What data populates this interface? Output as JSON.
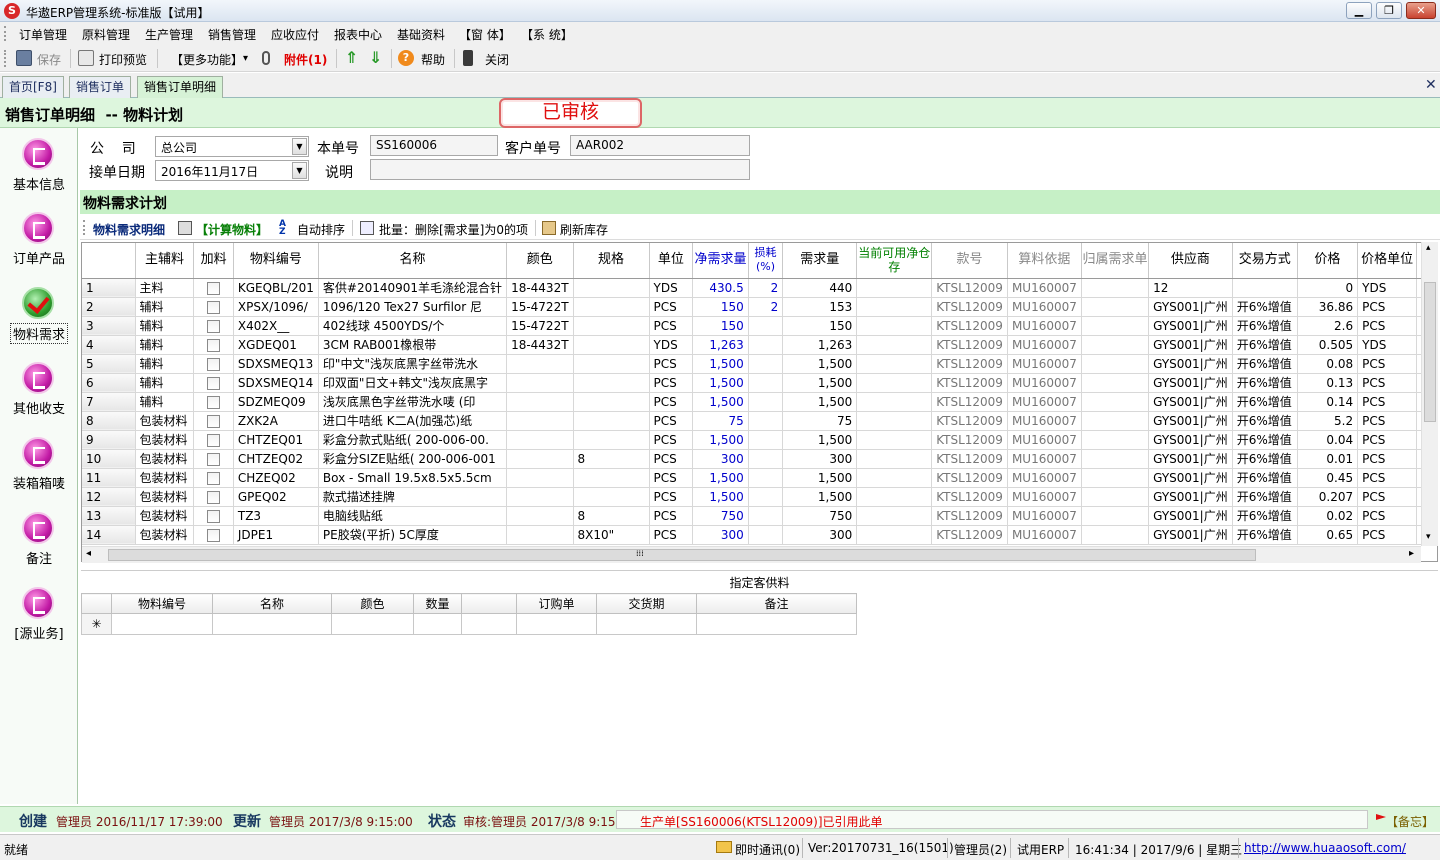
{
  "window": {
    "app_logo": "S",
    "title": "华遨ERP管理系统-标准版【试用】",
    "btn_min": "▁",
    "btn_max": "❐",
    "btn_close": "✕"
  },
  "menu": [
    "订单管理",
    "原料管理",
    "生产管理",
    "销售管理",
    "应收应付",
    "报表中心",
    "基础资料",
    "【窗 体】",
    "【系 统】"
  ],
  "toolbar": {
    "save": "保存",
    "print_preview": "打印预览",
    "more": "【更多功能】",
    "more_arrow": "▾",
    "attach": "附件(1)",
    "help": "帮助",
    "close": "关闭",
    "up_arrow": "⇑",
    "down_arrow": "⇓",
    "help_glyph": "?"
  },
  "tabs": [
    "首页[F8]",
    "销售订单",
    "销售订单明细"
  ],
  "tab_close": "✕",
  "header": {
    "title": "销售订单明细  -- 物料计划",
    "status_stamp": "已审核"
  },
  "sidebar": [
    "基本信息",
    "订单产品",
    "物料需求",
    "其他收支",
    "装箱箱唛",
    "备注",
    "[源业务]"
  ],
  "form": {
    "company_label": "公    司",
    "company_value": "总公司",
    "order_no_label": "本单号",
    "order_no_value": "SS160006",
    "customer_no_label": "客户单号",
    "customer_no_value": "AAR002",
    "date_label": "接单日期",
    "date_value": "2016年11月17日",
    "note_label": "说明",
    "note_value": "",
    "dropdown_glyph": "▼"
  },
  "section_title": "物料需求计划",
  "subbar": {
    "detail": "物料需求明细",
    "calc": "【计算物料】",
    "sort": "自动排序",
    "batch": "批量：删除[需求量]为0的项",
    "refresh": "刷新库存"
  },
  "grid": {
    "headers": [
      "",
      "主辅料",
      "加料",
      "物料编号",
      "名称",
      "颜色",
      "规格",
      "单位",
      "净需求量",
      "损耗(%)",
      "需求量",
      "当前可用净仓存",
      "款号",
      "算料依据",
      "归属需求单",
      "供应商",
      "交易方式",
      "价格",
      "价格单位",
      ""
    ],
    "rows": [
      {
        "no": "1",
        "type": "主料",
        "code": "KGEQBL/201",
        "name": "客供#20140901羊毛涤纶混合针",
        "color": "18-4432T",
        "spec": "",
        "unit": "YDS",
        "net": "430.5",
        "loss": "2",
        "qty": "440",
        "stock": "",
        "style": "KTSL12009",
        "basis": "MU160007",
        "belong": "",
        "supplier": "12",
        "trade": "",
        "price": "0",
        "punit": "YDS"
      },
      {
        "no": "2",
        "type": "辅料",
        "code": "XPSX/1096/",
        "name": "1096/120  Tex27 Surfilor 尼",
        "color": "15-4722T",
        "spec": "",
        "unit": "PCS",
        "net": "150",
        "loss": "2",
        "qty": "153",
        "stock": "",
        "style": "KTSL12009",
        "basis": "MU160007",
        "belong": "",
        "supplier": "GYS001|广州",
        "trade": "开6%增值",
        "price": "36.86",
        "punit": "PCS"
      },
      {
        "no": "3",
        "type": "辅料",
        "code": "X402X__",
        "name": "402线球 4500YDS/个",
        "color": "15-4722T",
        "spec": "",
        "unit": "PCS",
        "net": "150",
        "loss": "",
        "qty": "150",
        "stock": "",
        "style": "KTSL12009",
        "basis": "MU160007",
        "belong": "",
        "supplier": "GYS001|广州",
        "trade": "开6%增值",
        "price": "2.6",
        "punit": "PCS"
      },
      {
        "no": "4",
        "type": "辅料",
        "code": "XGDEQ01",
        "name": "3CM RAB001橡根带",
        "color": "18-4432T",
        "spec": "",
        "unit": "YDS",
        "net": "1,263",
        "loss": "",
        "qty": "1,263",
        "stock": "",
        "style": "KTSL12009",
        "basis": "MU160007",
        "belong": "",
        "supplier": "GYS001|广州",
        "trade": "开6%增值",
        "price": "0.505",
        "punit": "YDS"
      },
      {
        "no": "5",
        "type": "辅料",
        "code": "SDXSMEQ13",
        "name": "印\"中文\"浅灰底黑字丝带洗水",
        "color": "",
        "spec": "",
        "unit": "PCS",
        "net": "1,500",
        "loss": "",
        "qty": "1,500",
        "stock": "",
        "style": "KTSL12009",
        "basis": "MU160007",
        "belong": "",
        "supplier": "GYS001|广州",
        "trade": "开6%增值",
        "price": "0.08",
        "punit": "PCS"
      },
      {
        "no": "6",
        "type": "辅料",
        "code": "SDXSMEQ14",
        "name": "印双面\"日文+韩文\"浅灰底黑字",
        "color": "",
        "spec": "",
        "unit": "PCS",
        "net": "1,500",
        "loss": "",
        "qty": "1,500",
        "stock": "",
        "style": "KTSL12009",
        "basis": "MU160007",
        "belong": "",
        "supplier": "GYS001|广州",
        "trade": "开6%增值",
        "price": "0.13",
        "punit": "PCS"
      },
      {
        "no": "7",
        "type": "辅料",
        "code": "SDZMEQ09",
        "name": "浅灰底黑色字丝带洗水唛 (印",
        "color": "",
        "spec": "",
        "unit": "PCS",
        "net": "1,500",
        "loss": "",
        "qty": "1,500",
        "stock": "",
        "style": "KTSL12009",
        "basis": "MU160007",
        "belong": "",
        "supplier": "GYS001|广州",
        "trade": "开6%增值",
        "price": "0.14",
        "punit": "PCS"
      },
      {
        "no": "8",
        "type": "包装材料",
        "code": "ZXK2A",
        "name": "进口牛咭纸 K二A(加强芯)纸",
        "color": "",
        "spec": "",
        "unit": "PCS",
        "net": "75",
        "loss": "",
        "qty": "75",
        "stock": "",
        "style": "KTSL12009",
        "basis": "MU160007",
        "belong": "",
        "supplier": "GYS001|广州",
        "trade": "开6%增值",
        "price": "5.2",
        "punit": "PCS"
      },
      {
        "no": "9",
        "type": "包装材料",
        "code": "CHTZEQ01",
        "name": "彩盒分款式贴纸( 200-006-00.",
        "color": "",
        "spec": "",
        "unit": "PCS",
        "net": "1,500",
        "loss": "",
        "qty": "1,500",
        "stock": "",
        "style": "KTSL12009",
        "basis": "MU160007",
        "belong": "",
        "supplier": "GYS001|广州",
        "trade": "开6%增值",
        "price": "0.04",
        "punit": "PCS"
      },
      {
        "no": "10",
        "type": "包装材料",
        "code": "CHTZEQ02",
        "name": "彩盒分SIZE贴纸( 200-006-001",
        "color": "",
        "spec": "8",
        "unit": "PCS",
        "net": "300",
        "loss": "",
        "qty": "300",
        "stock": "",
        "style": "KTSL12009",
        "basis": "MU160007",
        "belong": "",
        "supplier": "GYS001|广州",
        "trade": "开6%增值",
        "price": "0.01",
        "punit": "PCS"
      },
      {
        "no": "11",
        "type": "包装材料",
        "code": "CHZEQ02",
        "name": "Box - Small 19.5x8.5x5.5cm",
        "color": "",
        "spec": "",
        "unit": "PCS",
        "net": "1,500",
        "loss": "",
        "qty": "1,500",
        "stock": "",
        "style": "KTSL12009",
        "basis": "MU160007",
        "belong": "",
        "supplier": "GYS001|广州",
        "trade": "开6%增值",
        "price": "0.45",
        "punit": "PCS"
      },
      {
        "no": "12",
        "type": "包装材料",
        "code": "GPEQ02",
        "name": "款式描述挂牌",
        "color": "",
        "spec": "",
        "unit": "PCS",
        "net": "1,500",
        "loss": "",
        "qty": "1,500",
        "stock": "",
        "style": "KTSL12009",
        "basis": "MU160007",
        "belong": "",
        "supplier": "GYS001|广州",
        "trade": "开6%增值",
        "price": "0.207",
        "punit": "PCS"
      },
      {
        "no": "13",
        "type": "包装材料",
        "code": "TZ3",
        "name": "电脑线贴纸",
        "color": "",
        "spec": "8",
        "unit": "PCS",
        "net": "750",
        "loss": "",
        "qty": "750",
        "stock": "",
        "style": "KTSL12009",
        "basis": "MU160007",
        "belong": "",
        "supplier": "GYS001|广州",
        "trade": "开6%增值",
        "price": "0.02",
        "punit": "PCS"
      },
      {
        "no": "14",
        "type": "包装材料",
        "code": "JDPE1",
        "name": "PE胶袋(平折) 5C厚度",
        "color": "",
        "spec": "8X10\"",
        "unit": "PCS",
        "net": "300",
        "loss": "",
        "qty": "300",
        "stock": "",
        "style": "KTSL12009",
        "basis": "MU160007",
        "belong": "",
        "supplier": "GYS001|广州",
        "trade": "开6%增值",
        "price": "0.65",
        "punit": "PCS"
      }
    ]
  },
  "scroll": {
    "grip": "⁞⁞⁞",
    "left": "◂",
    "right": "▸",
    "up": "▴",
    "down": "▾"
  },
  "lower": {
    "title": "指定客供料",
    "headers": [
      "",
      "物料编号",
      "名称",
      "颜色",
      "数量",
      "",
      "订购单",
      "交货期",
      "备注"
    ],
    "new_row_marker": "✳"
  },
  "info": {
    "created_label": "创建",
    "created_value": "管理员 2016/11/17 17:39:00",
    "updated_label": "更新",
    "updated_value": "管理员 2017/3/8 9:15:00",
    "status_label": "状态",
    "status_value": "审核:管理员 2017/3/8 9:15",
    "message": "生产单[SS160006(KTSL12009)]已引用此单",
    "memo": "【备忘】"
  },
  "status": {
    "ready": "就绪",
    "im": "即时通讯(0)",
    "version": "Ver:20170731_16(1501)",
    "user": "管理员(2)",
    "mode": "试用ERP",
    "datetime": "16:41:34 | 2017/9/6 | 星期三",
    "url": "http://www.huaaosoft.com/"
  },
  "colors": {
    "accent_green": "#ddf6dd",
    "section_green": "#c6f0c6",
    "stamp_red": "#e01010",
    "blue_value": "#0000cc"
  }
}
